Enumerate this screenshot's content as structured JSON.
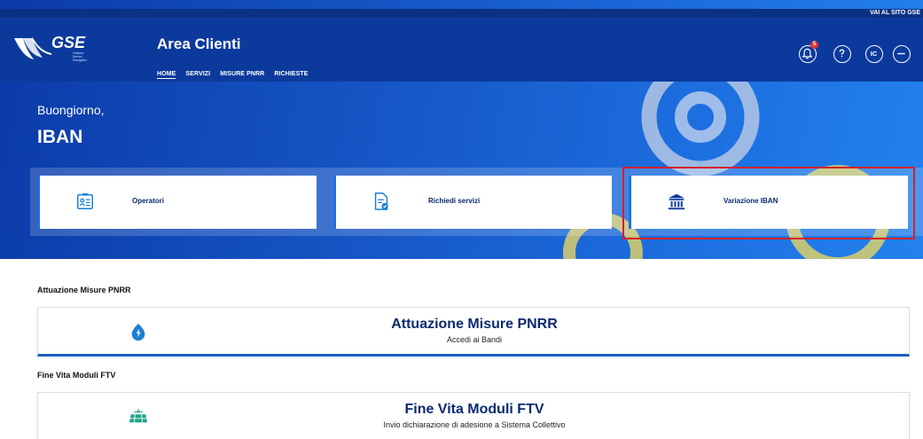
{
  "top_strip": {
    "visit_site": "VAI AL SITO GSE"
  },
  "header": {
    "logo_text": "GSE",
    "logo_sub": [
      "Gestore",
      "Servizi",
      "Energetici"
    ],
    "title": "Area Clienti",
    "nav": [
      "HOME",
      "SERVIZI",
      "MISURE PNRR",
      "RICHIESTE"
    ],
    "notification_count": "5",
    "user_initials": "IC"
  },
  "greeting": {
    "hello": "Buongiorno,",
    "name": "IBAN"
  },
  "quick_cards": [
    {
      "label": "Operatori",
      "icon": "id-card-icon"
    },
    {
      "label": "Richiedi servizi",
      "icon": "document-check-icon"
    },
    {
      "label": "Variazione IBAN",
      "icon": "bank-icon"
    }
  ],
  "sections": [
    {
      "heading": "Attuazione Misure PNRR",
      "card_title": "Attuazione Misure PNRR",
      "card_subtitle": "Accedi ai Bandi",
      "icon": "energy-leaf-icon"
    },
    {
      "heading": "Fine Vita Moduli FTV",
      "card_title": "Fine Vita Moduli FTV",
      "card_subtitle": "Invio dichiarazione di adesione a Sistema Collettivo",
      "icon": "solar-panel-recycle-icon"
    }
  ],
  "colors": {
    "brand_blue": "#0c3a9c",
    "accent": "#1d6fe0",
    "highlight_red": "#d62028",
    "badge_red": "#e3342f"
  }
}
